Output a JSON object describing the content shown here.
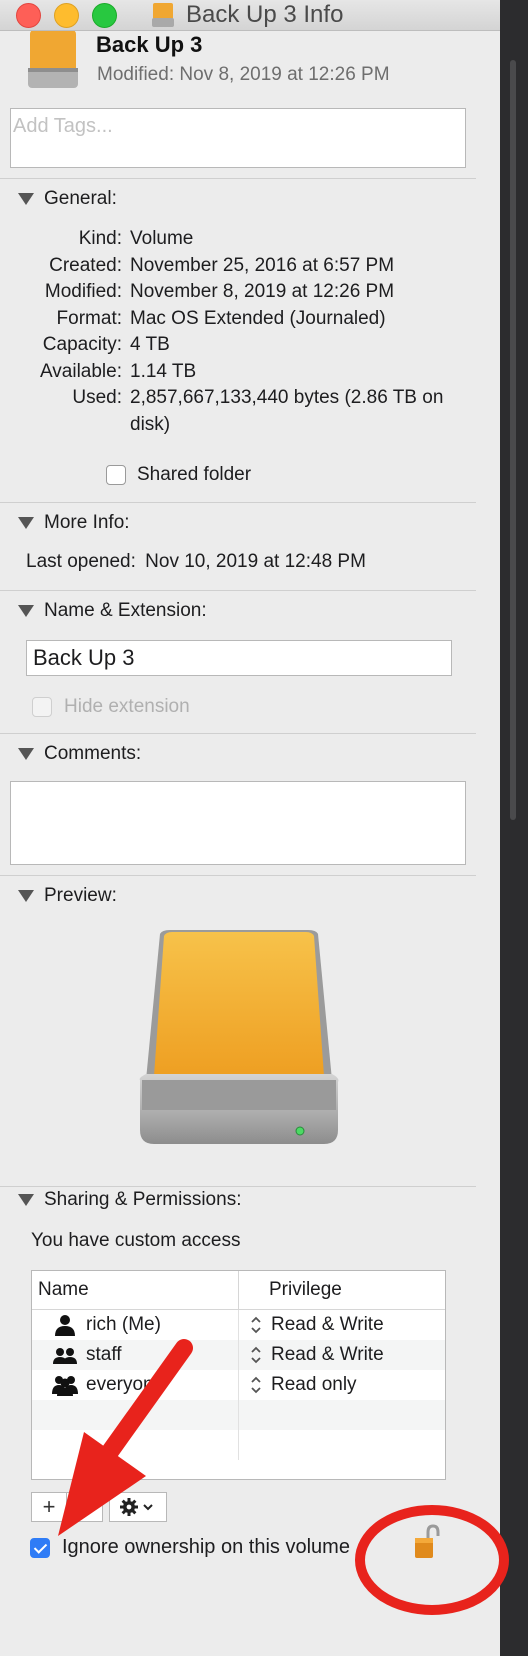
{
  "window": {
    "title": "Back Up 3 Info"
  },
  "header": {
    "name": "Back Up 3",
    "modified": "Modified: Nov 8, 2019 at 12:26 PM"
  },
  "tags": {
    "placeholder": "Add Tags..."
  },
  "general": {
    "title": "General:",
    "rows": [
      {
        "k": "Kind:",
        "v": "Volume"
      },
      {
        "k": "Created:",
        "v": "November 25, 2016 at 6:57 PM"
      },
      {
        "k": "Modified:",
        "v": "November 8, 2019 at 12:26 PM"
      },
      {
        "k": "Format:",
        "v": "Mac OS Extended (Journaled)"
      },
      {
        "k": "Capacity:",
        "v": "4 TB"
      },
      {
        "k": "Available:",
        "v": "1.14 TB"
      },
      {
        "k": "Used:",
        "v": "2,857,667,133,440 bytes (2.86 TB on disk)"
      }
    ],
    "shared_folder": "Shared folder"
  },
  "more_info": {
    "title": "More Info:",
    "last_opened_label": "Last opened:",
    "last_opened_value": "Nov 10, 2019 at 12:48 PM"
  },
  "name_ext": {
    "title": "Name & Extension:",
    "value": "Back Up 3",
    "hide_extension": "Hide extension"
  },
  "comments": {
    "title": "Comments:"
  },
  "preview": {
    "title": "Preview:"
  },
  "sharing": {
    "title": "Sharing & Permissions:",
    "access": "You have custom access",
    "col_name": "Name",
    "col_privilege": "Privilege",
    "rows": [
      {
        "name": "rich (Me)",
        "privilege": "Read & Write"
      },
      {
        "name": "staff",
        "privilege": "Read & Write"
      },
      {
        "name": "everyone",
        "privilege": "Read only"
      }
    ],
    "add_label": "+",
    "remove_label": "−",
    "ignore_ownership": "Ignore ownership on this volume"
  },
  "colors": {
    "drive_orange": "#f0a732",
    "annotation_red": "#e8231c",
    "checkbox_blue": "#2f7cf6"
  }
}
